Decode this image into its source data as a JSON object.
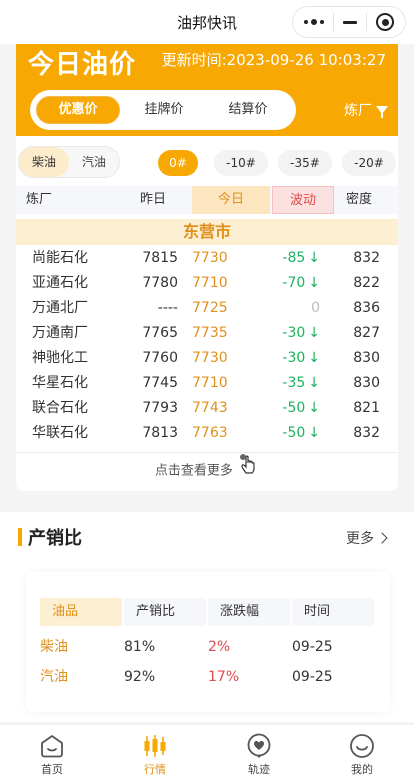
{
  "nav": {
    "title": "油邦快讯"
  },
  "hero": {
    "title": "今日油价",
    "update_time": "更新时间:2023-09-26 10:03:27",
    "price_tabs": [
      "优惠价",
      "挂牌价",
      "结算价"
    ],
    "refinery_filter": "炼厂"
  },
  "fuel_types": [
    "柴油",
    "汽油"
  ],
  "grades": [
    "0#",
    "-10#",
    "-35#",
    "-20#"
  ],
  "table": {
    "headers": [
      "炼厂",
      "昨日",
      "今日",
      "波动",
      "密度"
    ],
    "city": "东营市",
    "rows": [
      {
        "name": "尚能石化",
        "yesterday": "7815",
        "today": "7730",
        "change": "-85",
        "density": "832"
      },
      {
        "name": "亚通石化",
        "yesterday": "7780",
        "today": "7710",
        "change": "-70",
        "density": "822"
      },
      {
        "name": "万通北厂",
        "yesterday": "----",
        "today": "7725",
        "change": "0",
        "density": "836"
      },
      {
        "name": "万通南厂",
        "yesterday": "7765",
        "today": "7735",
        "change": "-30",
        "density": "827"
      },
      {
        "name": "神驰化工",
        "yesterday": "7760",
        "today": "7730",
        "change": "-30",
        "density": "830"
      },
      {
        "name": "华星石化",
        "yesterday": "7745",
        "today": "7710",
        "change": "-35",
        "density": "830"
      },
      {
        "name": "联合石化",
        "yesterday": "7793",
        "today": "7743",
        "change": "-50",
        "density": "821"
      },
      {
        "name": "华联石化",
        "yesterday": "7813",
        "today": "7763",
        "change": "-50",
        "density": "832"
      }
    ],
    "see_more": "点击查看更多"
  },
  "ratio": {
    "title": "产销比",
    "more": "更多",
    "headers": [
      "油品",
      "产销比",
      "涨跌幅",
      "时间"
    ],
    "rows": [
      {
        "product": "柴油",
        "ratio": "81%",
        "change": "2%",
        "time": "09-25"
      },
      {
        "product": "汽油",
        "ratio": "92%",
        "change": "17%",
        "time": "09-25"
      }
    ]
  },
  "tabbar": [
    "首页",
    "行情",
    "轨迹",
    "我的"
  ],
  "colors": {
    "accent": "#f7a803",
    "down": "#1eb15f",
    "up": "#e04b4b"
  }
}
